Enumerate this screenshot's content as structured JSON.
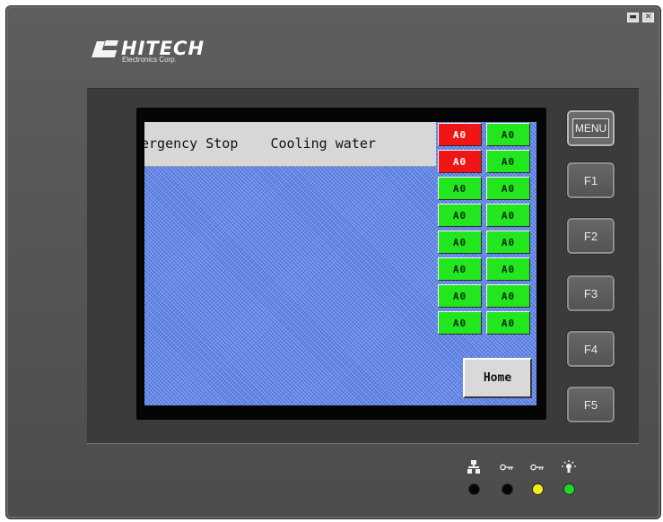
{
  "window": {
    "minimize_label": "▬",
    "close_label": "✕"
  },
  "logo": {
    "brand": "HITECH",
    "subtitle": "Electronics Corp."
  },
  "alarm": {
    "text": "ergency Stop    Cooling water"
  },
  "indicators": [
    [
      "A0",
      "A0"
    ],
    [
      "A0",
      "A0"
    ],
    [
      "A0",
      "A0"
    ],
    [
      "A0",
      "A0"
    ],
    [
      "A0",
      "A0"
    ],
    [
      "A0",
      "A0"
    ],
    [
      "A0",
      "A0"
    ],
    [
      "A0",
      "A0"
    ]
  ],
  "indicator_colors": {
    "on": "#f01616",
    "off": "#22e61e"
  },
  "indicator_states": [
    [
      "red",
      "green"
    ],
    [
      "red",
      "green"
    ],
    [
      "green",
      "green"
    ],
    [
      "green",
      "green"
    ],
    [
      "green",
      "green"
    ],
    [
      "green",
      "green"
    ],
    [
      "green",
      "green"
    ],
    [
      "green",
      "green"
    ]
  ],
  "home_button": {
    "label": "Home"
  },
  "keys": {
    "menu": "MENU",
    "f1": "F1",
    "f2": "F2",
    "f3": "F3",
    "f4": "F4",
    "f5": "F5"
  },
  "status_leds": [
    {
      "icon": "network-icon",
      "color": "#050505"
    },
    {
      "icon": "key-icon",
      "color": "#050505"
    },
    {
      "icon": "key-icon",
      "color": "#f4ee12"
    },
    {
      "icon": "light-icon",
      "color": "#1fd81f"
    }
  ]
}
